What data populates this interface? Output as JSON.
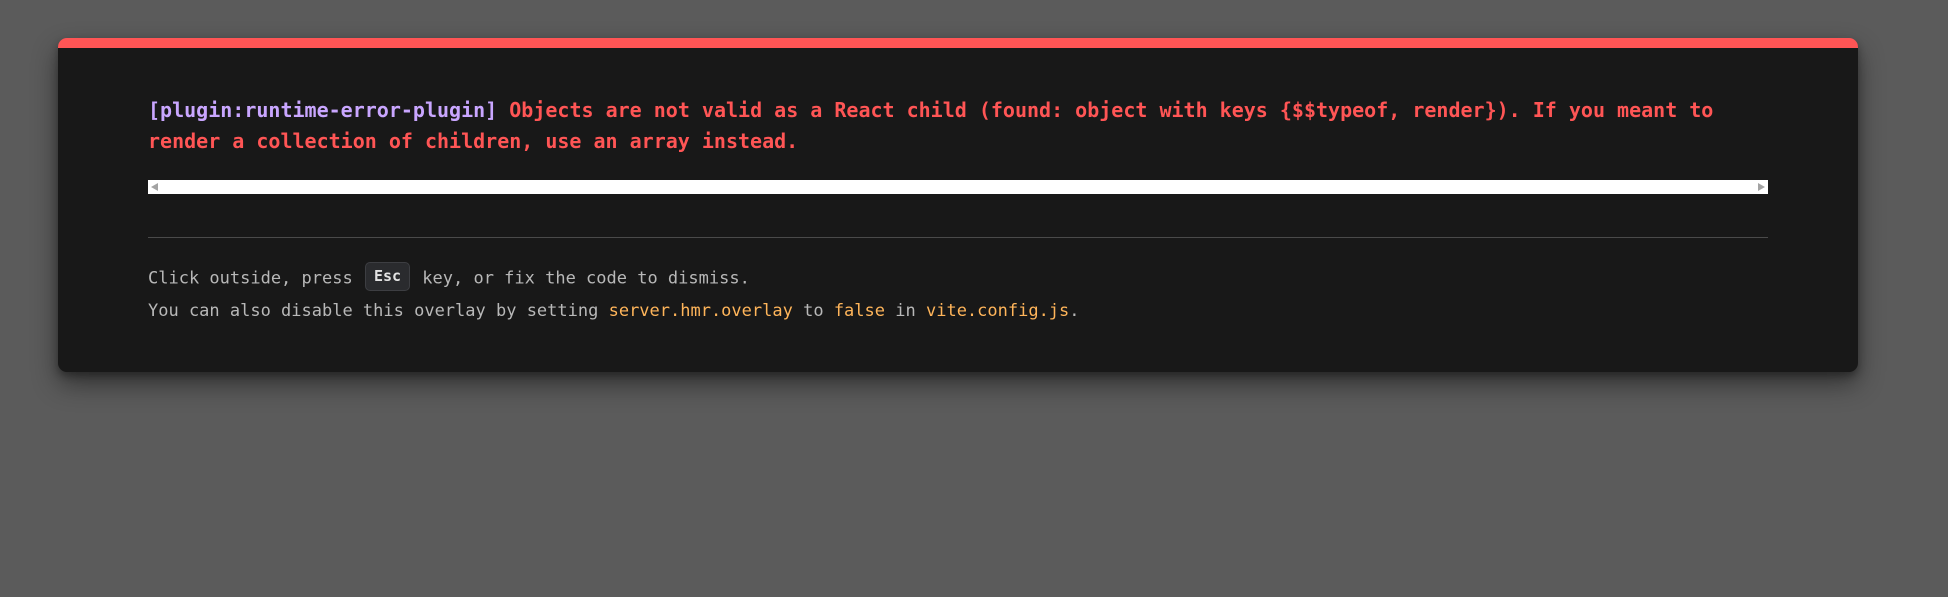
{
  "overlay": {
    "plugin": "[plugin:runtime-error-plugin]",
    "message": "Objects are not valid as a React child (found: object with keys {$$typeof, render}). If you meant to render a collection of children, use an array instead.",
    "tip1": {
      "before": "Click outside, press",
      "key": "Esc",
      "after": "key, or fix the code to dismiss."
    },
    "tip2": {
      "part1": "You can also disable this overlay by setting",
      "setting": "server.hmr.overlay",
      "part2": "to",
      "value": "false",
      "part3": "in",
      "file": "vite.config.js",
      "end": "."
    }
  },
  "colors": {
    "accent_bar": "#ff5555",
    "plugin_text": "#c9a6ff",
    "error_text": "#ff5555",
    "code_text": "#ffb55a",
    "panel_bg": "#181818",
    "backdrop": "#5b5b5b"
  }
}
